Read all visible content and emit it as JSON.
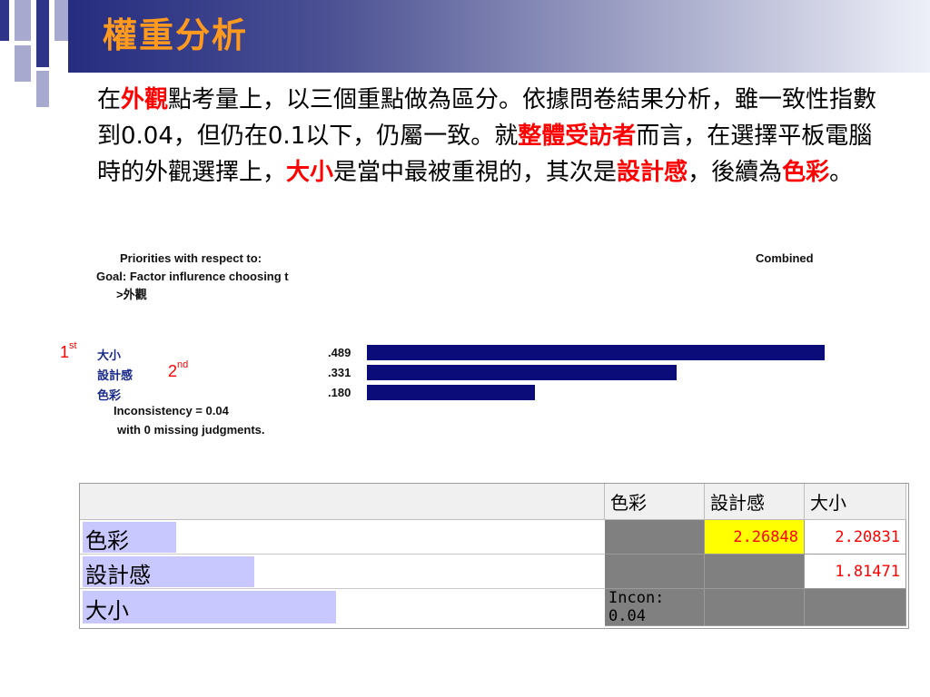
{
  "slide": {
    "title": "權重分析"
  },
  "paragraph": {
    "p1": "在",
    "h1": "外觀",
    "p2": "點考量上，以三個重點做為區分。依據問卷結果分析，雖一致性指數到0.04，但仍在0.1以下，仍屬一致。就",
    "h2": "整體受訪者",
    "p3": "而言，在選擇平板電腦時的外觀選擇上，",
    "h3": "大小",
    "p4": "是當中最被重視的，其次是",
    "h4": "設計感",
    "p5": "，後續為",
    "h5": "色彩",
    "p6": "。"
  },
  "priorities": {
    "title": "Priorities with respect to:",
    "goal": "Goal: Factor influrence choosing t",
    "goal_cont": ">外觀",
    "combined": "Combined",
    "rank1_num": "1",
    "rank1_sup": "st",
    "rank2_num": "2",
    "rank2_sup": "nd",
    "inconsistency": "Inconsistency = 0.04",
    "missing": "with 0  missing judgments.",
    "rows": [
      {
        "label": "大小",
        "value": ".489",
        "weight": 0.489
      },
      {
        "label": "設計感",
        "value": ".331",
        "weight": 0.331
      },
      {
        "label": "色彩",
        "value": ".180",
        "weight": 0.18
      }
    ],
    "bar_color": "#0b0b7a"
  },
  "matrix": {
    "headers": [
      "色彩",
      "設計感",
      "大小"
    ],
    "rows": [
      {
        "label": "色彩",
        "weight": 0.18,
        "cells": [
          "",
          "2.26848",
          "2.20831"
        ]
      },
      {
        "label": "設計感",
        "weight": 0.331,
        "cells": [
          "",
          "",
          "1.81471"
        ]
      },
      {
        "label": "大小",
        "weight": 0.489,
        "cells": [
          "Incon: 0.04",
          "",
          ""
        ]
      }
    ],
    "highlight_color": "#ffff00",
    "value_color": "#ff0000",
    "bar_color": "#c8c8ff"
  }
}
